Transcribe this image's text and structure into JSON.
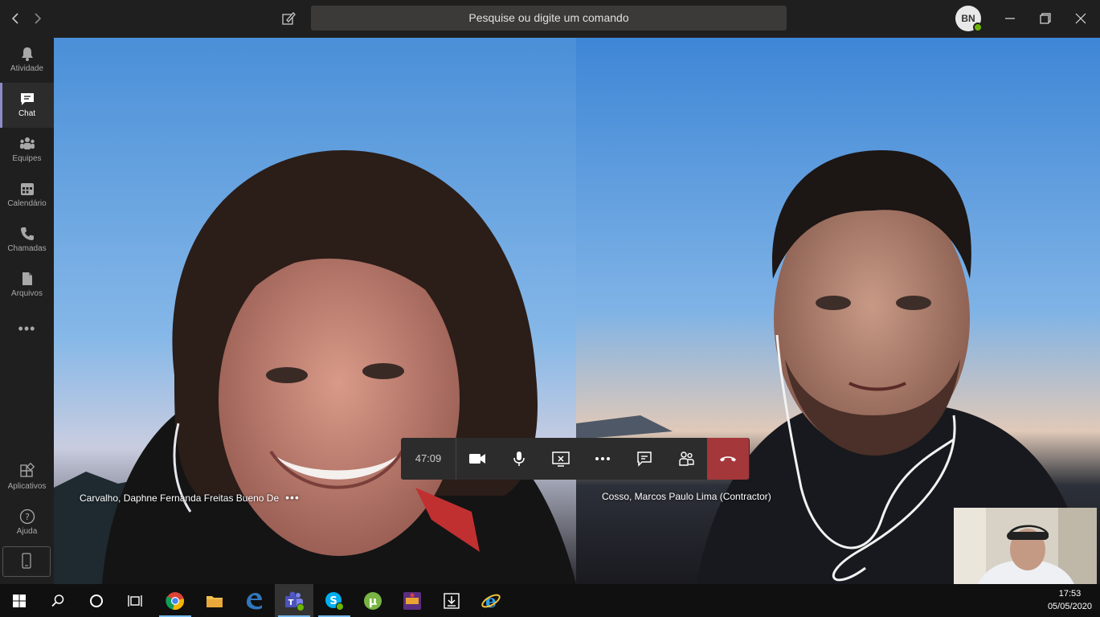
{
  "titlebar": {
    "search_placeholder": "Pesquise ou digite um comando",
    "avatar_initials": "BN"
  },
  "rail": {
    "items": [
      {
        "label": "Atividade",
        "icon": "bell-icon"
      },
      {
        "label": "Chat",
        "icon": "chat-icon",
        "active": true
      },
      {
        "label": "Equipes",
        "icon": "teams-icon"
      },
      {
        "label": "Calendário",
        "icon": "calendar-icon"
      },
      {
        "label": "Chamadas",
        "icon": "phone-icon"
      },
      {
        "label": "Arquivos",
        "icon": "file-icon"
      }
    ],
    "more": "•••",
    "bottom": [
      {
        "label": "Aplicativos",
        "icon": "apps-icon"
      },
      {
        "label": "Ajuda",
        "icon": "help-icon"
      }
    ]
  },
  "call": {
    "participants": [
      {
        "name": "Carvalho, Daphne Fernanda Freitas Bueno De",
        "more": "•••"
      },
      {
        "name": "Cosso, Marcos Paulo Lima (Contractor)"
      }
    ],
    "timer": "47:09"
  },
  "taskbar": {
    "time": "17:53",
    "date": "05/05/2020"
  },
  "colors": {
    "accent": "#8b8cc7",
    "hangup": "#a4373a",
    "presence": "#6bb700"
  }
}
